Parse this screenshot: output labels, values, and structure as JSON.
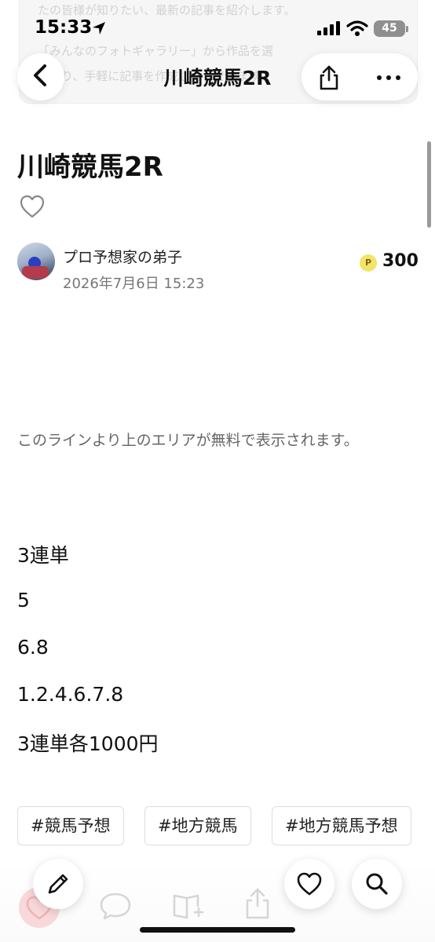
{
  "background": {
    "lines": [
      "たの皆様が知りたい、最新の記事を紹介します。",
      "「みんなのフォトギャラリー」から作品を選",
      "んだり、手軽に記事を作成したりできます。"
    ]
  },
  "status_bar": {
    "time": "15:33",
    "battery": "45"
  },
  "nav": {
    "title": "川崎競馬2R",
    "back_icon": "chevron-left-icon",
    "share_icon": "share-icon",
    "more_icon": "more-horizontal-icon"
  },
  "article": {
    "title": "川崎競馬2R",
    "author": "プロ予想家の弟子",
    "date": "2026年7月6日 15:23",
    "point_badge": "P",
    "points": "300",
    "free_area_notice": "このラインより上のエリアが無料で表示されます。",
    "body": [
      "3連単",
      "5",
      "6.8",
      "1.2.4.6.7.8",
      "3連単各1000円"
    ],
    "tags": [
      "#競馬予想",
      "#地方競馬",
      "#地方競馬予想"
    ]
  },
  "colors": {
    "background": "#ffffff",
    "text": "#111111",
    "muted": "#777777",
    "point_badge": "#f2e36b"
  }
}
